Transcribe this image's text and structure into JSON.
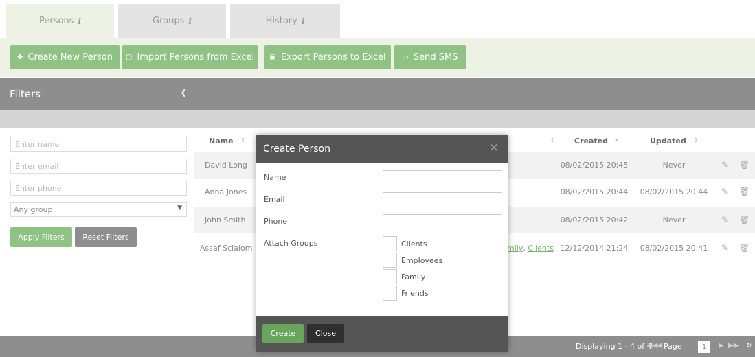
{
  "tabs": [
    {
      "label": "Persons",
      "info": "i"
    },
    {
      "label": "Groups",
      "info": "i"
    },
    {
      "label": "History",
      "info": "i"
    }
  ],
  "toolbar": {
    "create": "Create New Person",
    "import": "Import Persons from Excel",
    "export": "Export Persons to Excel",
    "sms": "Send SMS"
  },
  "filters": {
    "title": "Filters",
    "name_placeholder": "Enter name",
    "email_placeholder": "Enter email",
    "phone_placeholder": "Enter phone",
    "group_selected": "Any group",
    "apply": "Apply Filters",
    "reset": "Reset Filters"
  },
  "grid": {
    "headers": {
      "name": "Name",
      "created": "Created",
      "updated": "Updated"
    },
    "rows": [
      {
        "name": "David Long",
        "groups": [],
        "created": "08/02/2015 20:45",
        "updated": "Never"
      },
      {
        "name": "Anna Jones",
        "groups": [],
        "created": "08/02/2015 20:44",
        "updated": "08/02/2015 20:44"
      },
      {
        "name": "John Smith",
        "groups": [],
        "created": "08/02/2015 20:42",
        "updated": "Never"
      },
      {
        "name": "Assaf Scialom",
        "groups": [
          "mily",
          "Clients"
        ],
        "created": "12/12/2014 21:24",
        "updated": "08/02/2015 20:41"
      }
    ]
  },
  "footer": {
    "display": "Displaying 1 - 4 of 4",
    "page_label": "Page",
    "page_value": "1"
  },
  "modal": {
    "title": "Create Person",
    "fields": {
      "name": "Name",
      "email": "Email",
      "phone": "Phone",
      "groups": "Attach Groups"
    },
    "groups": [
      "Clients",
      "Employees",
      "Family",
      "Friends"
    ],
    "create": "Create",
    "close": "Close"
  },
  "colors": {
    "green": "#8fc384",
    "header_gray": "#8e8e8e",
    "modal_dark": "#555555"
  }
}
